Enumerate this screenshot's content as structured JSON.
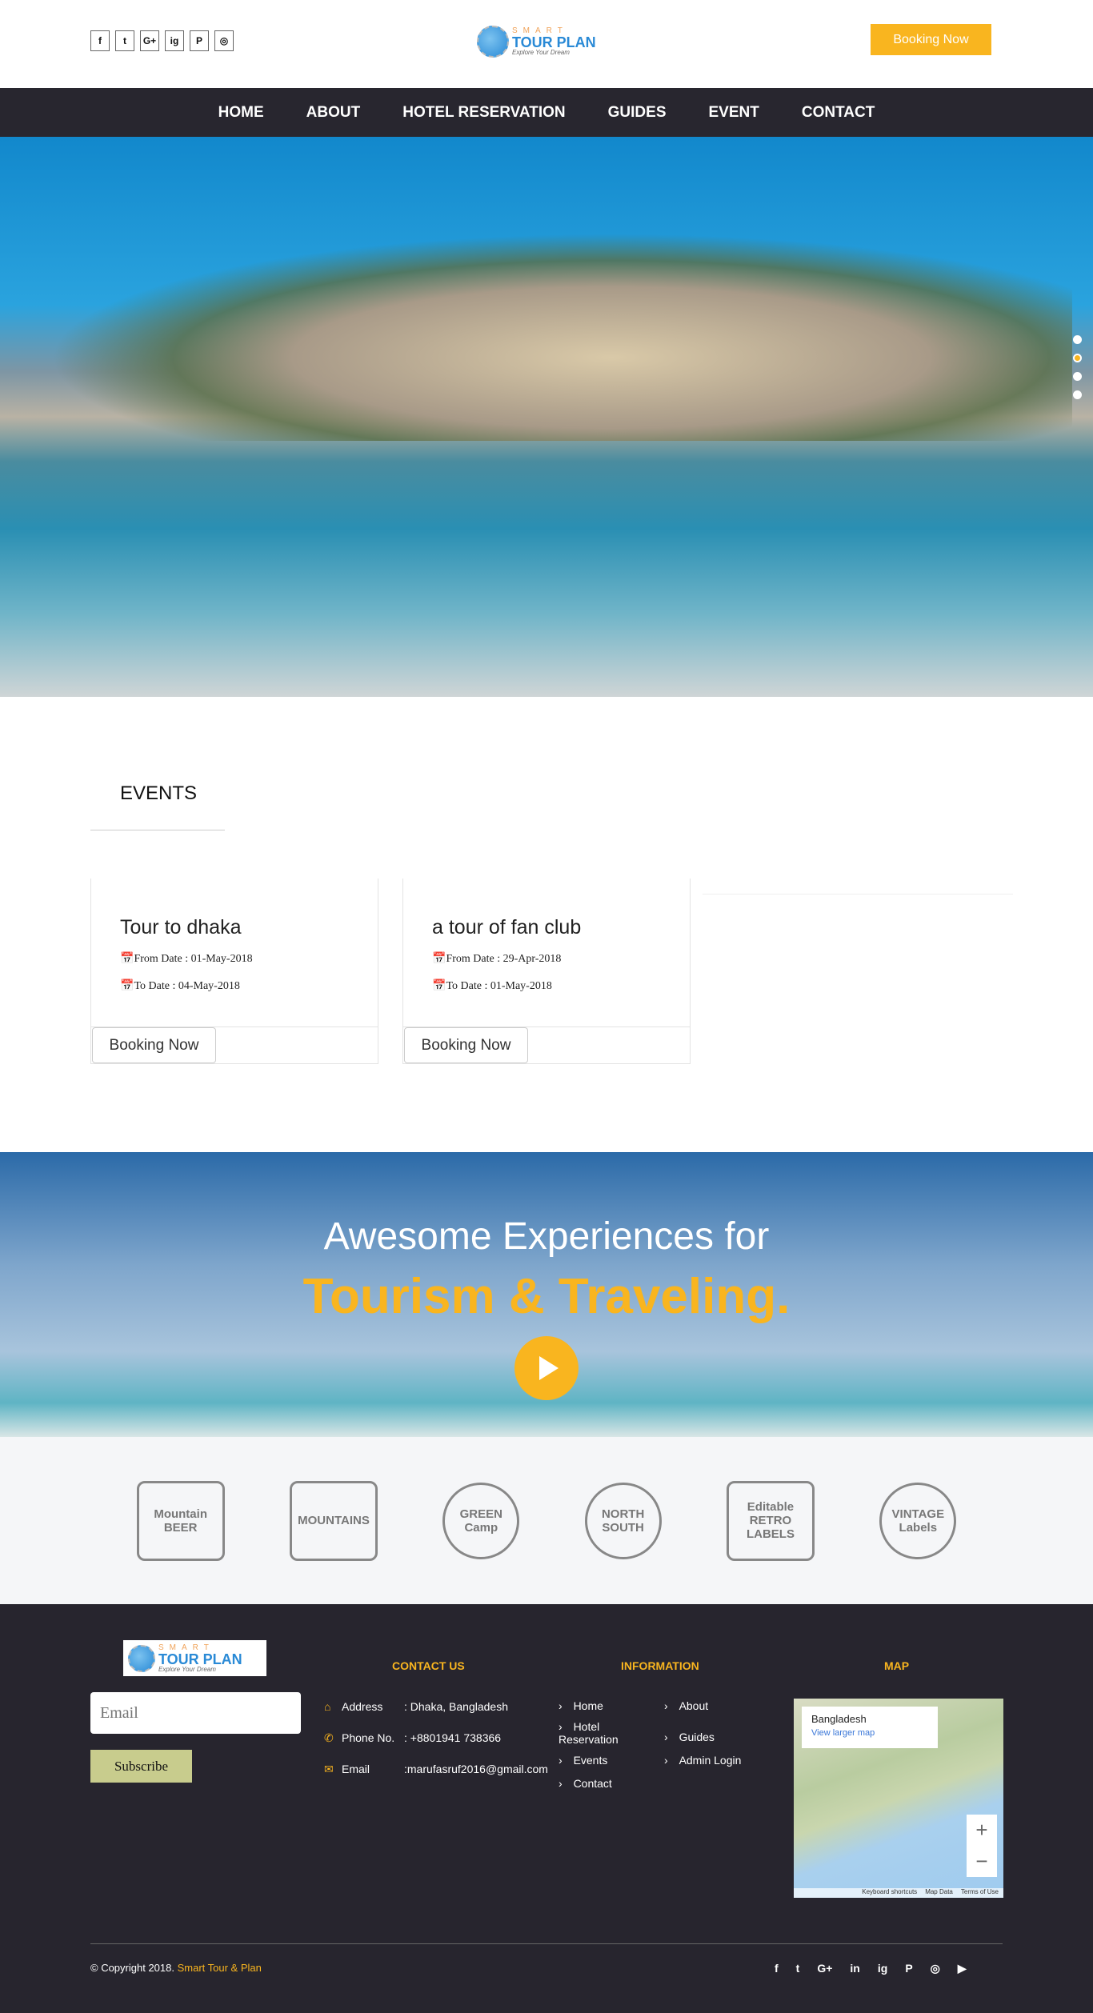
{
  "header": {
    "social": [
      "f",
      "t",
      "G+",
      "ig",
      "P",
      "◎"
    ],
    "social_icons": [
      "facebook-icon",
      "twitter-icon",
      "google-plus-icon",
      "instagram-icon",
      "pinterest-icon",
      "flickr-icon"
    ],
    "logo": {
      "top": "SMART",
      "main": "TOUR PLAN",
      "tag": "Explore Your Dream"
    },
    "booking_label": "Booking Now"
  },
  "nav": [
    "HOME",
    "ABOUT",
    "HOTEL RESERVATION",
    "GUIDES",
    "EVENT",
    "CONTACT"
  ],
  "slider": {
    "slides": 4,
    "active": 2
  },
  "events": {
    "title": "EVENTS",
    "cards": [
      {
        "title": "Tour to dhaka",
        "from": "From Date : 01-May-2018",
        "to": "To Date : 04-May-2018",
        "button": "Booking Now"
      },
      {
        "title": "a tour of fan club",
        "from": "From Date : 29-Apr-2018",
        "to": "To Date : 01-May-2018",
        "button": "Booking Now"
      }
    ]
  },
  "banner": {
    "line1": "Awesome Experiences for",
    "line2": "Tourism & Traveling."
  },
  "brands": [
    "Mountain BEER",
    "MOUNTAINS",
    "GREEN Camp",
    "NORTH SOUTH",
    "Editable RETRO LABELS",
    "VINTAGE Labels"
  ],
  "footer": {
    "email_placeholder": "Email",
    "subscribe": "Subscribe",
    "contact_title": "CONTACT US",
    "info_title": "INFORMATION",
    "map_title": "MAP",
    "contact": [
      {
        "label": "Address",
        "value": ": Dhaka, Bangladesh"
      },
      {
        "label": "Phone No.",
        "value": ": +8801941 738366"
      },
      {
        "label": "Email",
        "value": ":marufasruf2016@gmail.com"
      }
    ],
    "info_left": [
      "Home",
      "Hotel Reservation",
      "Events",
      "Contact"
    ],
    "info_right": [
      "About",
      "Guides",
      "Admin Login"
    ],
    "map": {
      "place": "Bangladesh",
      "link": "View larger map",
      "zoom_in": "+",
      "zoom_out": "−",
      "footer": [
        "Keyboard shortcuts",
        "Map Data",
        "Terms of Use"
      ]
    },
    "copyright": "© Copyright 2018.",
    "brand": "Smart Tour & Plan",
    "social": [
      "f",
      "t",
      "G+",
      "in",
      "ig",
      "P",
      "◎",
      "▶"
    ]
  },
  "colors": {
    "accent": "#f9b51f",
    "dark": "#28262f",
    "subscribe": "#c8cc8d"
  }
}
